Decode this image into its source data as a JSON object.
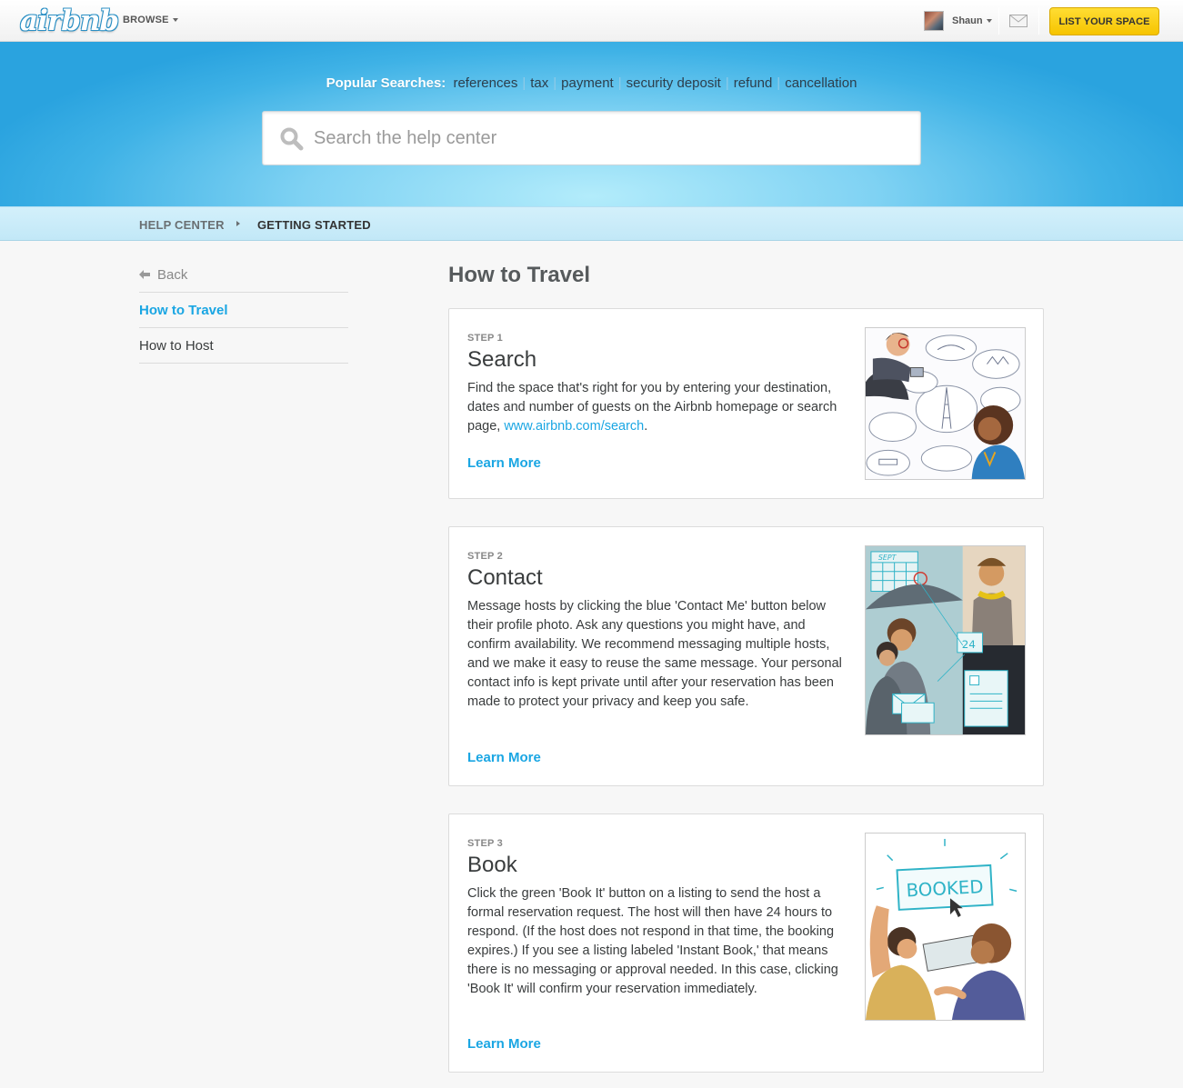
{
  "header": {
    "logo_text": "airbnb",
    "browse_label": "BROWSE",
    "user_name": "Shaun",
    "list_space_label": "LIST YOUR SPACE"
  },
  "hero": {
    "popular_label": "Popular Searches:",
    "popular_links": [
      "references",
      "tax",
      "payment",
      "security deposit",
      "refund",
      "cancellation"
    ],
    "search_placeholder": "Search the help center",
    "search_value": ""
  },
  "breadcrumb": {
    "items": [
      "HELP CENTER",
      "GETTING STARTED"
    ]
  },
  "sidebar": {
    "back_label": "Back",
    "items": [
      {
        "label": "How to Travel",
        "active": true
      },
      {
        "label": "How to Host",
        "active": false
      }
    ]
  },
  "main": {
    "title": "How to Travel",
    "steps": [
      {
        "label": "STEP 1",
        "title": "Search",
        "text": "Find the space that's right for you by entering your destination, dates and number of guests on the Airbnb homepage or search page, ",
        "link_text": "www.airbnb.com/search",
        "text_after": ".",
        "learn_more": "Learn More"
      },
      {
        "label": "STEP 2",
        "title": "Contact",
        "text": "Message hosts by clicking the blue 'Contact Me' button below their profile photo. Ask any questions you might have, and confirm availability. We recommend messaging multiple hosts, and we make it easy to reuse the same message. Your personal contact info is kept private until after your reservation has been made to protect your privacy and keep you safe.",
        "learn_more": "Learn More"
      },
      {
        "label": "STEP 3",
        "title": "Book",
        "text": "Click the green 'Book It' button on a listing to send the host a formal reservation request. The host will then have 24 hours to respond. (If the host does not respond in that time, the booking expires.) If you see a listing labeled 'Instant Book,' that means there is no messaging or approval needed. In this case, clicking 'Book It' will confirm your reservation immediately.",
        "learn_more": "Learn More",
        "illus_sign": "BOOKED"
      }
    ],
    "illus2_calendar": "SEPT",
    "illus2_day": "24"
  },
  "colors": {
    "accent": "#1aa6e3",
    "cta": "#ffd21f",
    "hero_blue": "#2aa3df"
  }
}
